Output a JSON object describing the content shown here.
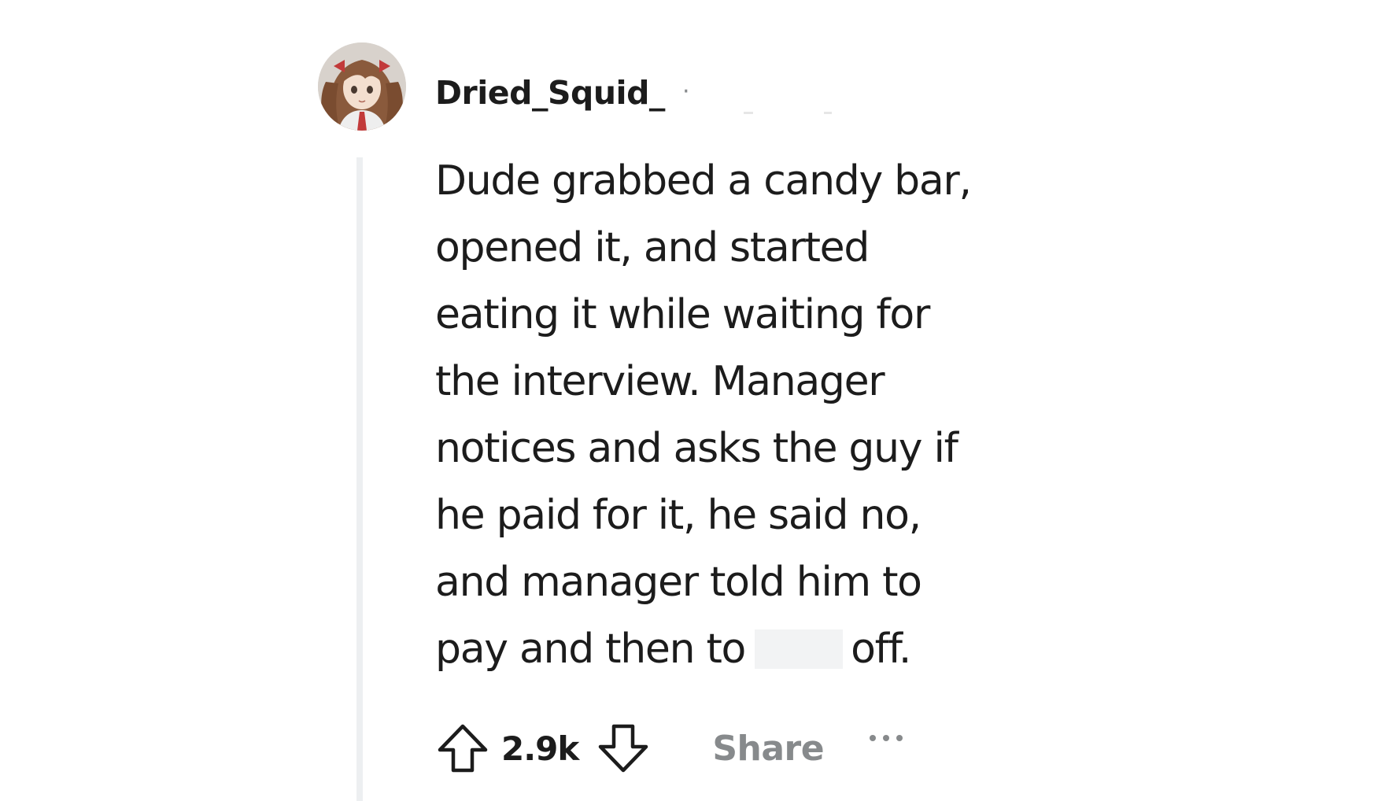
{
  "comment": {
    "author": {
      "username": "Dried_Squid_",
      "separator": "·"
    },
    "body_lines": [
      "Dude grabbed a candy bar,",
      "opened it, and started",
      "eating it while waiting for",
      "the interview. Manager",
      "notices and asks the guy if",
      "he paid for it, he said no,",
      "and manager told him to"
    ],
    "last_line": {
      "before": "pay and then to",
      "after": "off."
    },
    "actions": {
      "score": "2.9k",
      "share_label": "Share",
      "upvote_icon": "upvote-arrow-icon",
      "downvote_icon": "downvote-arrow-icon",
      "more_icon": "ellipsis-icon"
    }
  },
  "colors": {
    "text": "#1c1c1c",
    "muted": "#878a8c",
    "thread_line": "#edeff1"
  }
}
